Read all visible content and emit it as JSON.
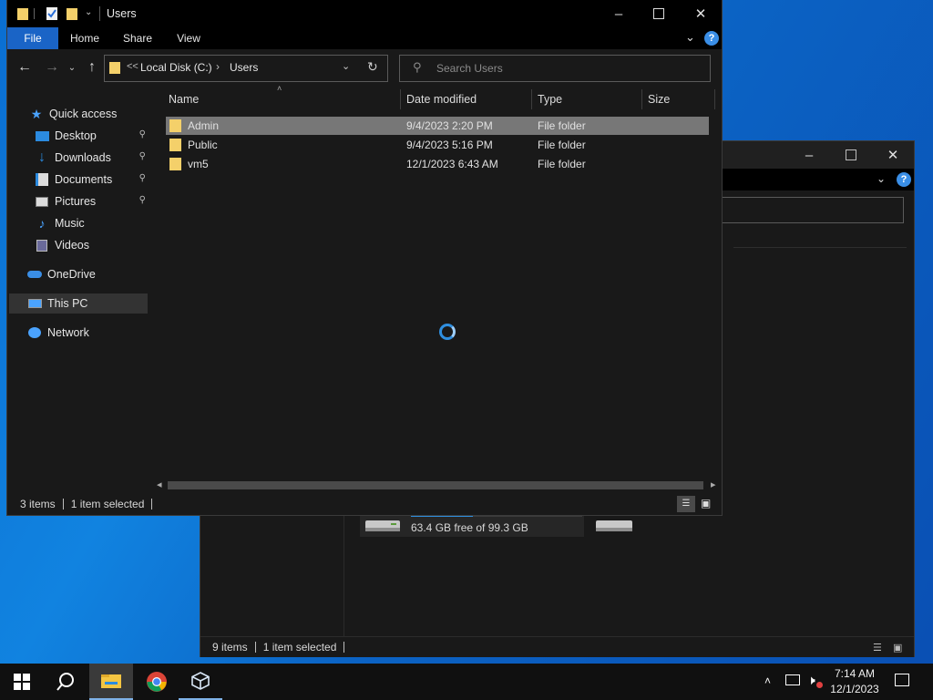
{
  "front": {
    "title": "Users",
    "ribbon_tabs": [
      "File",
      "Home",
      "Share",
      "View"
    ],
    "address": {
      "separator": "<<",
      "crumbs": [
        "Local Disk (C:)",
        "Users"
      ]
    },
    "search_placeholder": "Search Users",
    "nav": {
      "quick_access": "Quick access",
      "items": [
        "Desktop",
        "Downloads",
        "Documents",
        "Pictures",
        "Music",
        "Videos"
      ],
      "onedrive": "OneDrive",
      "this_pc": "This PC",
      "network": "Network"
    },
    "columns": {
      "name": "Name",
      "date": "Date modified",
      "type": "Type",
      "size": "Size"
    },
    "rows": [
      {
        "name": "Admin",
        "date": "9/4/2023 2:20 PM",
        "type": "File folder"
      },
      {
        "name": "Public",
        "date": "9/4/2023 5:16 PM",
        "type": "File folder"
      },
      {
        "name": "vm5",
        "date": "12/1/2023 6:43 AM",
        "type": "File folder"
      }
    ],
    "status": {
      "count": "3 items",
      "selected": "1 item selected"
    }
  },
  "back": {
    "drive_free": "63.4 GB free of 99.3 GB",
    "drive_used_fraction": 0.36,
    "status": {
      "count": "9 items",
      "selected": "1 item selected"
    }
  },
  "taskbar": {
    "time": "7:14 AM",
    "date": "12/1/2023"
  },
  "colors": {
    "accent": "#0a63c4",
    "folder": "#f4d06a",
    "selected_row": "#777777",
    "help": "#3a8ee6"
  }
}
